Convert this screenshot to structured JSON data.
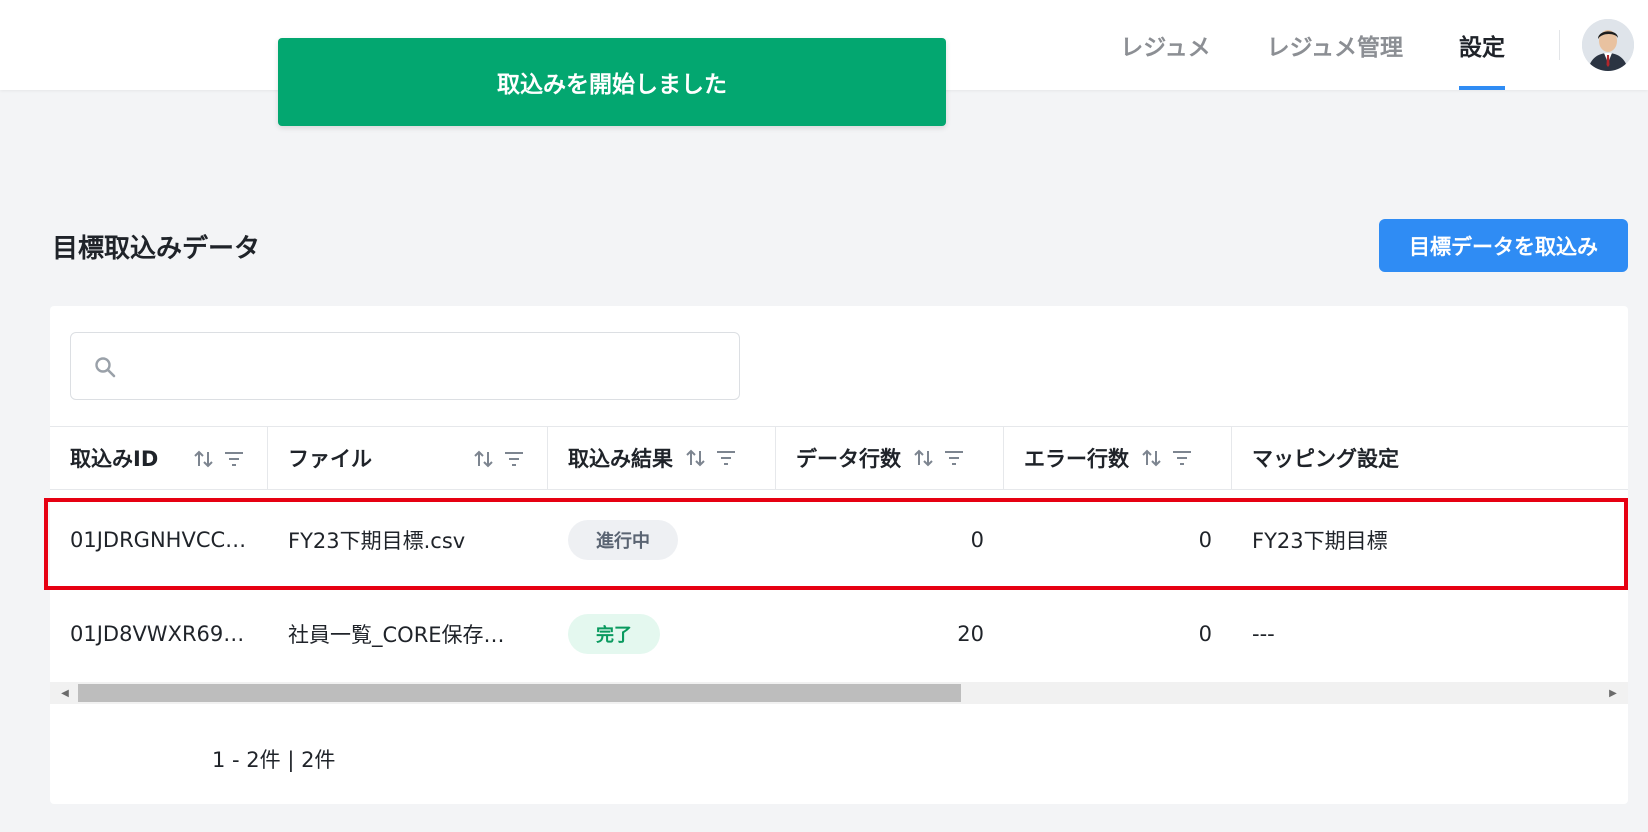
{
  "nav": {
    "items": [
      {
        "label": "レジュメ",
        "active": false
      },
      {
        "label": "レジュメ管理",
        "active": false
      },
      {
        "label": "設定",
        "active": true
      }
    ],
    "avatar_icon": "user-avatar"
  },
  "toast": {
    "message": "取込みを開始しました",
    "color": "#03a770"
  },
  "page": {
    "title": "目標取込みデータ",
    "import_button_label": "目標データを取込み",
    "accent_color": "#2f8cf4"
  },
  "search": {
    "icon": "search-icon",
    "value": "",
    "placeholder": ""
  },
  "table": {
    "columns": [
      {
        "label": "取込みID",
        "sortable": true,
        "filterable": true
      },
      {
        "label": "ファイル",
        "sortable": true,
        "filterable": true
      },
      {
        "label": "取込み結果",
        "sortable": true,
        "filterable": true
      },
      {
        "label": "データ行数",
        "sortable": true,
        "filterable": true
      },
      {
        "label": "エラー行数",
        "sortable": true,
        "filterable": true
      },
      {
        "label": "マッピング設定",
        "sortable": false,
        "filterable": false
      }
    ],
    "rows": [
      {
        "id": "01JDRGNHVCC…",
        "file": "FY23下期目標.csv",
        "status": "進行中",
        "data_rows": "0",
        "error_rows": "0",
        "mapping": "FY23下期目標",
        "highlighted": true
      },
      {
        "id": "01JD8VWXR69…",
        "file": "社員一覧_CORE保存…",
        "status": "完了",
        "data_rows": "20",
        "error_rows": "0",
        "mapping": "---",
        "highlighted": false
      }
    ],
    "horizontal_scroll_fraction": 0.58
  },
  "pager": {
    "summary": "1 - 2件 | 2件"
  }
}
